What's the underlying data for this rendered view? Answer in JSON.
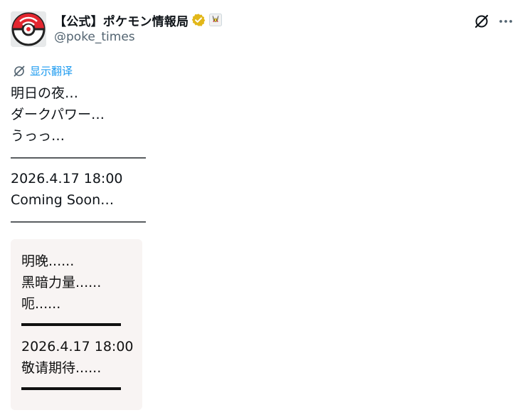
{
  "header": {
    "display_name": "【公式】ポケモン情報局",
    "handle": "@poke_times",
    "verified_icon": "gold-verified-badge",
    "affiliate_icon": "pikachu-affiliate-badge"
  },
  "translate": {
    "label": "显示翻译"
  },
  "tweet": {
    "lines": [
      "明日の夜…",
      "ダークパワー…",
      "うっっ…",
      "――――――――――",
      "2026.4.17 18:00",
      "Coming Soon…",
      "――――――――――"
    ]
  },
  "media": {
    "lines": [
      "明晚......",
      "黑暗力量......",
      "呃......",
      "",
      "2026.4.17 18:00",
      "敬请期待......",
      ""
    ]
  },
  "colors": {
    "accent": "#1d9bf0",
    "secondary_text": "#536471",
    "media_bg": "#f8f4f3"
  }
}
